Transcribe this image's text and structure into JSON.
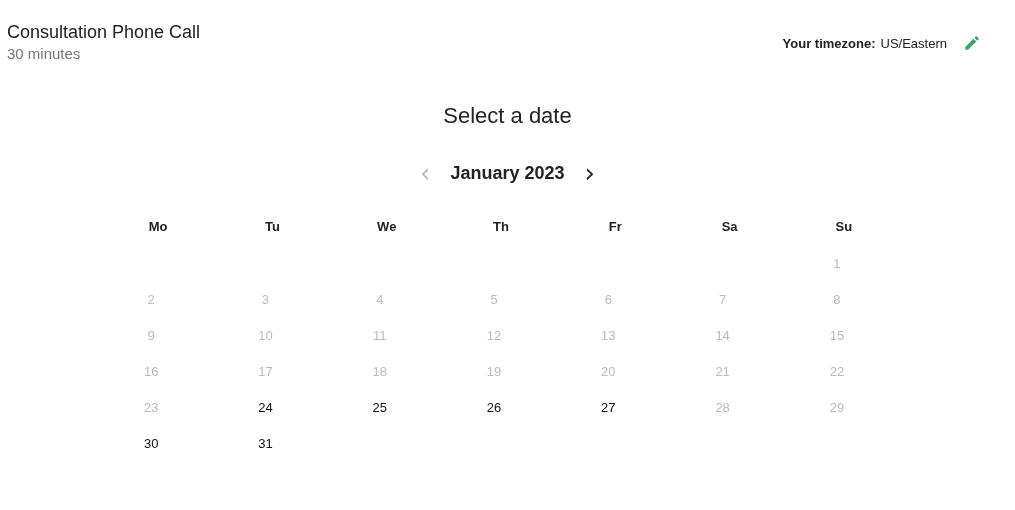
{
  "event": {
    "title": "Consultation Phone Call",
    "duration": "30 minutes"
  },
  "timezone": {
    "label": "Your timezone:",
    "value": "US/Eastern"
  },
  "heading": "Select a date",
  "month": {
    "label": "January 2023",
    "prev": {
      "label": "‹",
      "disabled": true
    },
    "next": {
      "label": "›",
      "disabled": false
    }
  },
  "weekdays": [
    "Mo",
    "Tu",
    "We",
    "Th",
    "Fr",
    "Sa",
    "Su"
  ],
  "weeks": [
    {
      "days": [
        {
          "kind": "blank"
        },
        {
          "kind": "blank"
        },
        {
          "kind": "blank"
        },
        {
          "kind": "blank"
        },
        {
          "kind": "blank"
        },
        {
          "kind": "blank"
        },
        {
          "kind": "day",
          "label": "1",
          "available": false
        }
      ]
    },
    {
      "days": [
        {
          "kind": "day",
          "label": "2",
          "available": false
        },
        {
          "kind": "day",
          "label": "3",
          "available": false
        },
        {
          "kind": "day",
          "label": "4",
          "available": false
        },
        {
          "kind": "day",
          "label": "5",
          "available": false
        },
        {
          "kind": "day",
          "label": "6",
          "available": false
        },
        {
          "kind": "day",
          "label": "7",
          "available": false
        },
        {
          "kind": "day",
          "label": "8",
          "available": false
        }
      ]
    },
    {
      "days": [
        {
          "kind": "day",
          "label": "9",
          "available": false
        },
        {
          "kind": "day",
          "label": "10",
          "available": false
        },
        {
          "kind": "day",
          "label": "11",
          "available": false
        },
        {
          "kind": "day",
          "label": "12",
          "available": false
        },
        {
          "kind": "day",
          "label": "13",
          "available": false
        },
        {
          "kind": "day",
          "label": "14",
          "available": false
        },
        {
          "kind": "day",
          "label": "15",
          "available": false
        }
      ]
    },
    {
      "days": [
        {
          "kind": "day",
          "label": "16",
          "available": false
        },
        {
          "kind": "day",
          "label": "17",
          "available": false
        },
        {
          "kind": "day",
          "label": "18",
          "available": false
        },
        {
          "kind": "day",
          "label": "19",
          "available": false
        },
        {
          "kind": "day",
          "label": "20",
          "available": false
        },
        {
          "kind": "day",
          "label": "21",
          "available": false
        },
        {
          "kind": "day",
          "label": "22",
          "available": false
        }
      ]
    },
    {
      "days": [
        {
          "kind": "day",
          "label": "23",
          "available": false
        },
        {
          "kind": "day",
          "label": "24",
          "available": true
        },
        {
          "kind": "day",
          "label": "25",
          "available": true
        },
        {
          "kind": "day",
          "label": "26",
          "available": true
        },
        {
          "kind": "day",
          "label": "27",
          "available": true
        },
        {
          "kind": "day",
          "label": "28",
          "available": false
        },
        {
          "kind": "day",
          "label": "29",
          "available": false
        }
      ]
    },
    {
      "days": [
        {
          "kind": "day",
          "label": "30",
          "available": true
        },
        {
          "kind": "day",
          "label": "31",
          "available": true
        },
        {
          "kind": "blank"
        },
        {
          "kind": "blank"
        },
        {
          "kind": "blank"
        },
        {
          "kind": "blank"
        },
        {
          "kind": "blank"
        }
      ]
    }
  ]
}
